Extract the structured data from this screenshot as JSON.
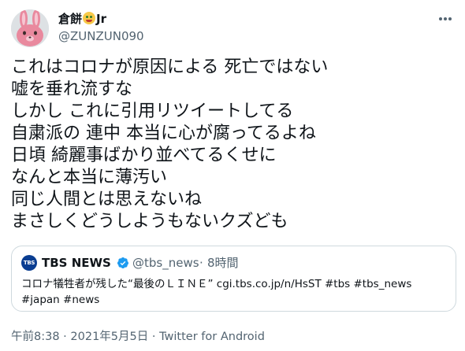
{
  "author": {
    "display_name": "倉餅",
    "display_suffix": "Jr",
    "handle": "@ZUNZUN090"
  },
  "tweet": {
    "lines": [
      "これはコロナが原因による 死亡ではない",
      "嘘を垂れ流すな",
      "しかし これに引用リツイートしてる",
      "自粛派の 連中 本当に心が腐ってるよね",
      "日頃 綺麗事ばかり並べてるくせに",
      "なんと本当に薄汚い",
      "同じ人間とは思えないね",
      "まさしくどうしようもないクズども"
    ]
  },
  "quote": {
    "logo_text": "TBS",
    "name": "TBS NEWS",
    "handle": "@tbs_news",
    "separator": "·",
    "time": "8時間",
    "body_line1": "コロナ犠牲者が残した“最後のＬＩＮＥ” cgi.tbs.co.jp/n/HsST #tbs #tbs_news",
    "body_line2": "#japan #news"
  },
  "meta": {
    "time": "午前8:38",
    "sep1": " · ",
    "date": "2021年5月5日",
    "sep2": " · ",
    "source": "Twitter for Android"
  },
  "colors": {
    "text_primary": "#0f1419",
    "text_secondary": "#536471",
    "verified_blue": "#1d9bf0",
    "border": "#cfd9de",
    "tbs_blue": "#0a3d91"
  },
  "icons": {
    "avatar": "bunny-avatar",
    "more": "more-horizontal-icon",
    "verified": "verified-badge-icon",
    "emoji": "money-mouth-face-emoji"
  }
}
